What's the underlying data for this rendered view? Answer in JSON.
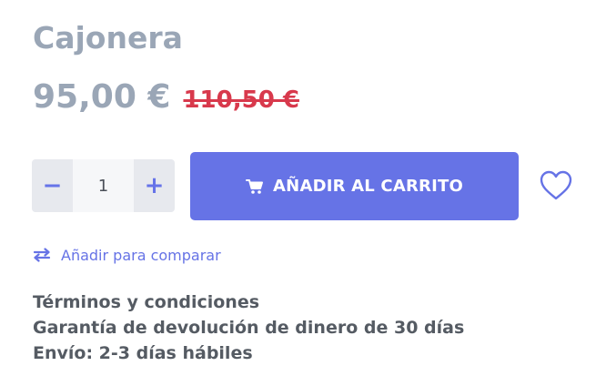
{
  "product": {
    "title": "Cajonera",
    "price_current": "95,00 €",
    "price_old": "110,50 €"
  },
  "quantity": {
    "decrement_label": "−",
    "value": "1",
    "increment_label": "+"
  },
  "actions": {
    "add_to_cart_label": "AÑADIR AL CARRITO",
    "add_to_cart_icon": "cart-icon",
    "wishlist_icon": "heart-icon",
    "compare_label": "Añadir para comparar",
    "compare_icon": "compare-arrows-icon"
  },
  "info": {
    "items": [
      "Términos y condiciones",
      "Garantía de devolución de dinero de 30 días",
      "Envío: 2-3 días hábiles"
    ]
  },
  "colors": {
    "accent": "#6673e6",
    "price": "#9aa6b6",
    "old_price": "#d8394c",
    "text": "#555b63",
    "stepper_bg": "#e7e9ee"
  }
}
